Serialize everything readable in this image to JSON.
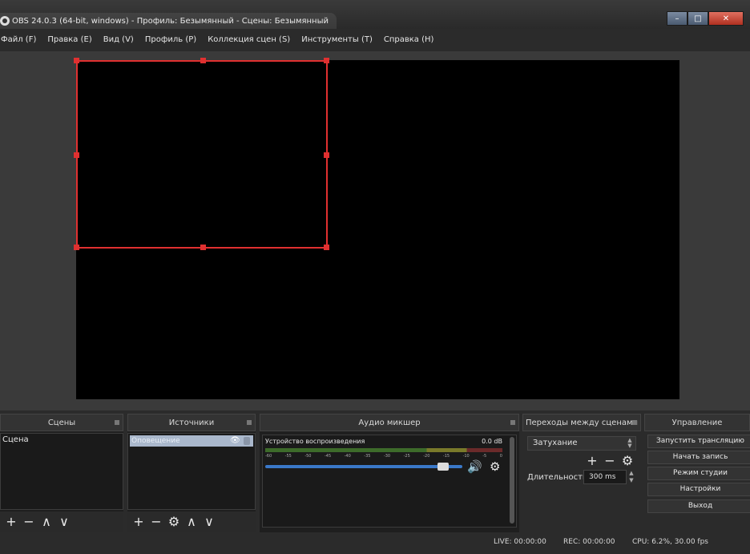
{
  "window": {
    "title": "OBS 24.0.3 (64-bit, windows) - Профиль: Безымянный - Сцены: Безымянный",
    "minimize_label": "–",
    "maximize_label": "□",
    "close_label": "✕"
  },
  "menu": [
    "Файл (F)",
    "Правка (E)",
    "Вид (V)",
    "Профиль (P)",
    "Коллекция сцен (S)",
    "Инструменты (T)",
    "Справка (H)"
  ],
  "scenes": {
    "header": "Сцены",
    "items": [
      "Сцена"
    ]
  },
  "sources": {
    "header": "Источники",
    "items": [
      "Оповещение"
    ]
  },
  "mixer": {
    "header": "Аудио микшер",
    "device": "Устройство воспроизведения",
    "level": "0.0 dB",
    "ticks": [
      "-60",
      "-55",
      "-50",
      "-45",
      "-40",
      "-35",
      "-30",
      "-25",
      "-20",
      "-15",
      "-10",
      "-5",
      "0"
    ],
    "fader_level": 0.93
  },
  "transitions": {
    "header": "Переходы между сценами",
    "selected": "Затухание",
    "duration_label": "Длительность",
    "duration_value": "300 ms"
  },
  "controls": {
    "header": "Управление",
    "buttons": [
      "Запустить трансляцию",
      "Начать запись",
      "Режим студии",
      "Настройки",
      "Выход"
    ]
  },
  "status": {
    "live": "LIVE: 00:00:00",
    "rec": "REC: 00:00:00",
    "cpu": "CPU: 6.2%, 30.00 fps"
  },
  "icons": {
    "plus": "+",
    "minus": "−",
    "up": "∧",
    "down": "∨",
    "gear": "⚙",
    "speaker": "🔊",
    "eye": "👁"
  },
  "colors": {
    "selection": "#e03030",
    "fader": "#3a78c8"
  }
}
